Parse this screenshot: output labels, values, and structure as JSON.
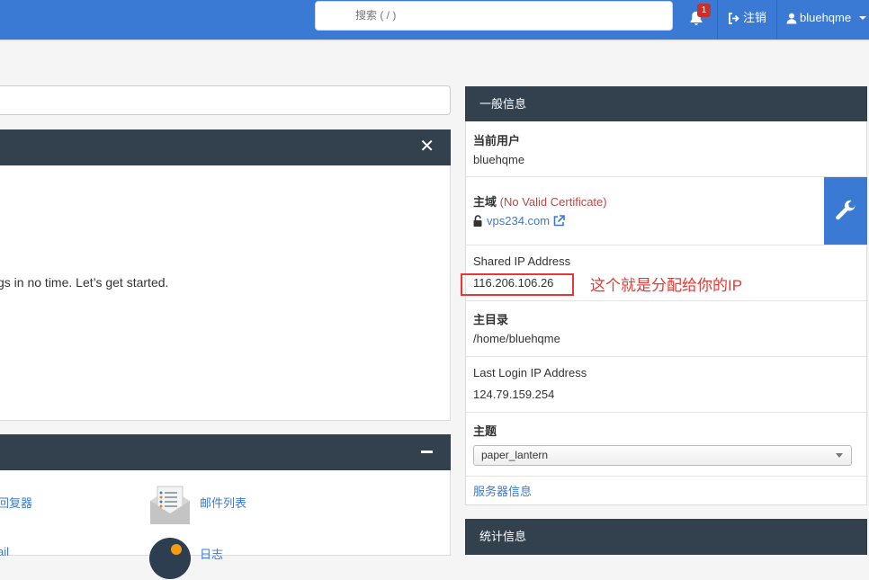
{
  "header": {
    "search_placeholder": "搜索 ( / )",
    "notification_count": "1",
    "logout_label": "注销",
    "username": "bluehqme"
  },
  "welcome": {
    "text": "gs in no time. Let’s get started."
  },
  "tools": {
    "item1": "回复器",
    "item2": "邮件列表",
    "item3": "ail",
    "item4": "日志"
  },
  "sidebar": {
    "title": "一般信息",
    "current_user_label": "当前用户",
    "current_user_value": "bluehqme",
    "domain_label": "主域",
    "domain_warning": "(No Valid Certificate)",
    "domain_value": "vps234.com",
    "shared_ip_label": "Shared IP Address",
    "shared_ip_value": "116.206.106.26",
    "home_label": "主目录",
    "home_value": "/home/bluehqme",
    "last_login_label": "Last Login IP Address",
    "last_login_value": "124.79.159.254",
    "theme_label": "主题",
    "theme_value": "paper_lantern",
    "server_info_link": "服务器信息"
  },
  "annotation": {
    "text": "这个就是分配给你的IP",
    "color": "#e53935"
  },
  "stats": {
    "title": "统计信息"
  },
  "colors": {
    "topbar": "#3a7ad5",
    "panel_header": "#33404e",
    "link": "#3a7ad5",
    "warning": "#b94a48"
  }
}
